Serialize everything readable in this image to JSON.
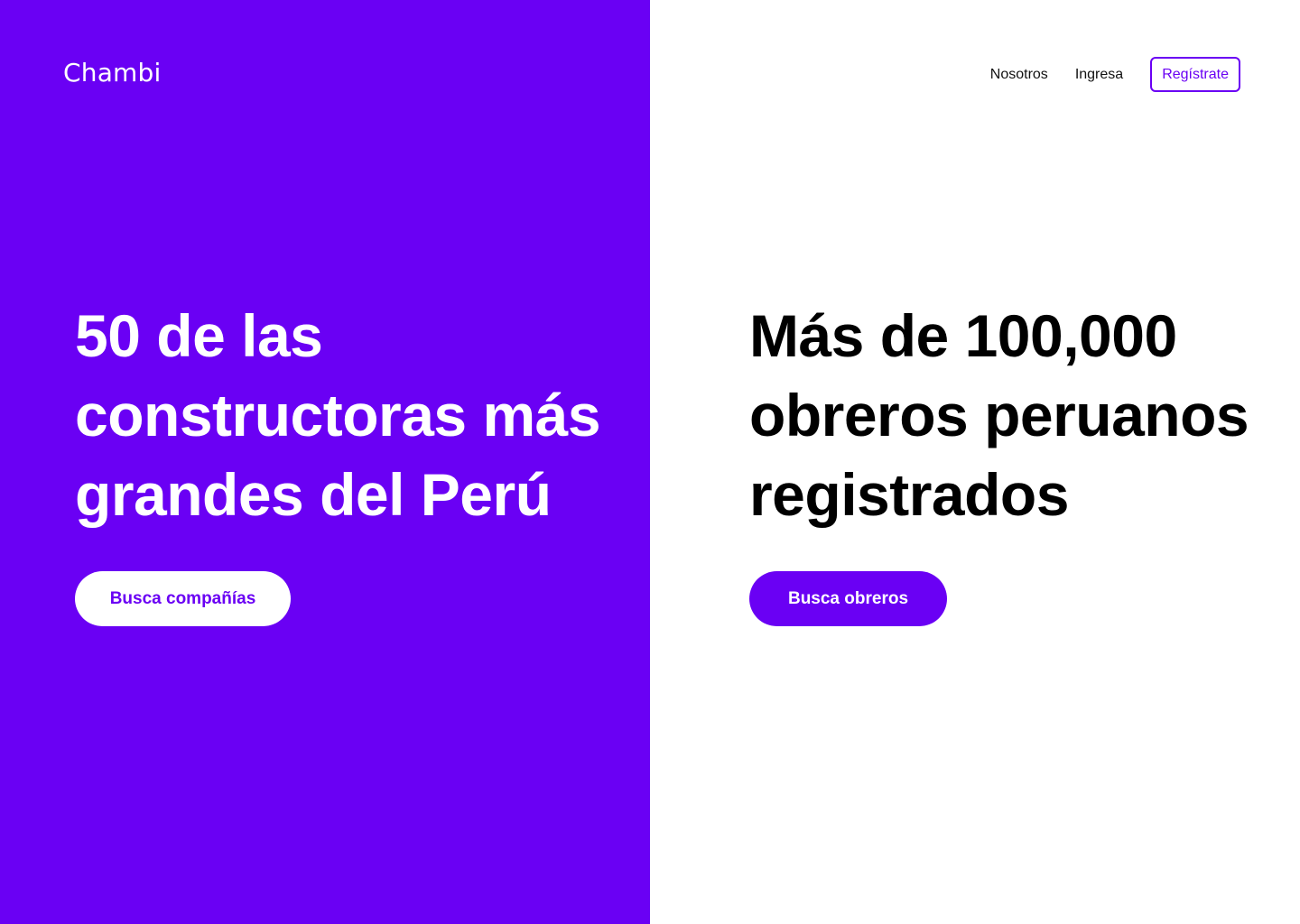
{
  "brand": {
    "logo": "Chambi",
    "primary_color": "#6a00f4"
  },
  "nav": {
    "about": "Nosotros",
    "login": "Ingresa",
    "register": "Regístrate"
  },
  "companies_panel": {
    "headline_lines": [
      "50 de las",
      "constructoras más",
      "grandes del Perú"
    ],
    "button_label": "Busca compañías"
  },
  "workers_panel": {
    "headline_lines": [
      "Más de 100,000",
      "obreros peruanos",
      "registrados"
    ],
    "button_label": "Busca obreros"
  }
}
